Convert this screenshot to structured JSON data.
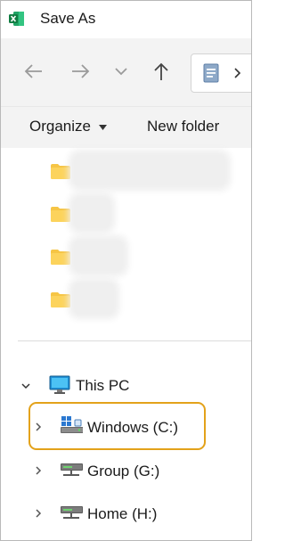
{
  "window": {
    "title": "Save As",
    "app_icon": "excel-icon"
  },
  "nav": {
    "back_icon": "arrow-left-icon",
    "forward_icon": "arrow-right-icon",
    "recent_icon": "chevron-down-icon",
    "up_icon": "arrow-up-icon",
    "address_icon": "document-icon"
  },
  "command_bar": {
    "organize_label": "Organize",
    "new_folder_label": "New folder"
  },
  "folders": [
    {
      "icon": "folder-icon",
      "name_blurred": true
    },
    {
      "icon": "folder-icon",
      "name_blurred": true
    },
    {
      "icon": "folder-icon",
      "name_blurred": true
    },
    {
      "icon": "folder-icon",
      "name_blurred": true
    }
  ],
  "tree": {
    "this_pc": {
      "label": "This PC",
      "expanded": true
    },
    "drives": [
      {
        "label": "Windows (C:)",
        "highlighted": true
      },
      {
        "label": "Group (G:)"
      },
      {
        "label": "Home (H:)"
      }
    ]
  },
  "colors": {
    "highlight": "#e3a21a",
    "folder": "#f6c545",
    "excel": "#1d6f42"
  }
}
